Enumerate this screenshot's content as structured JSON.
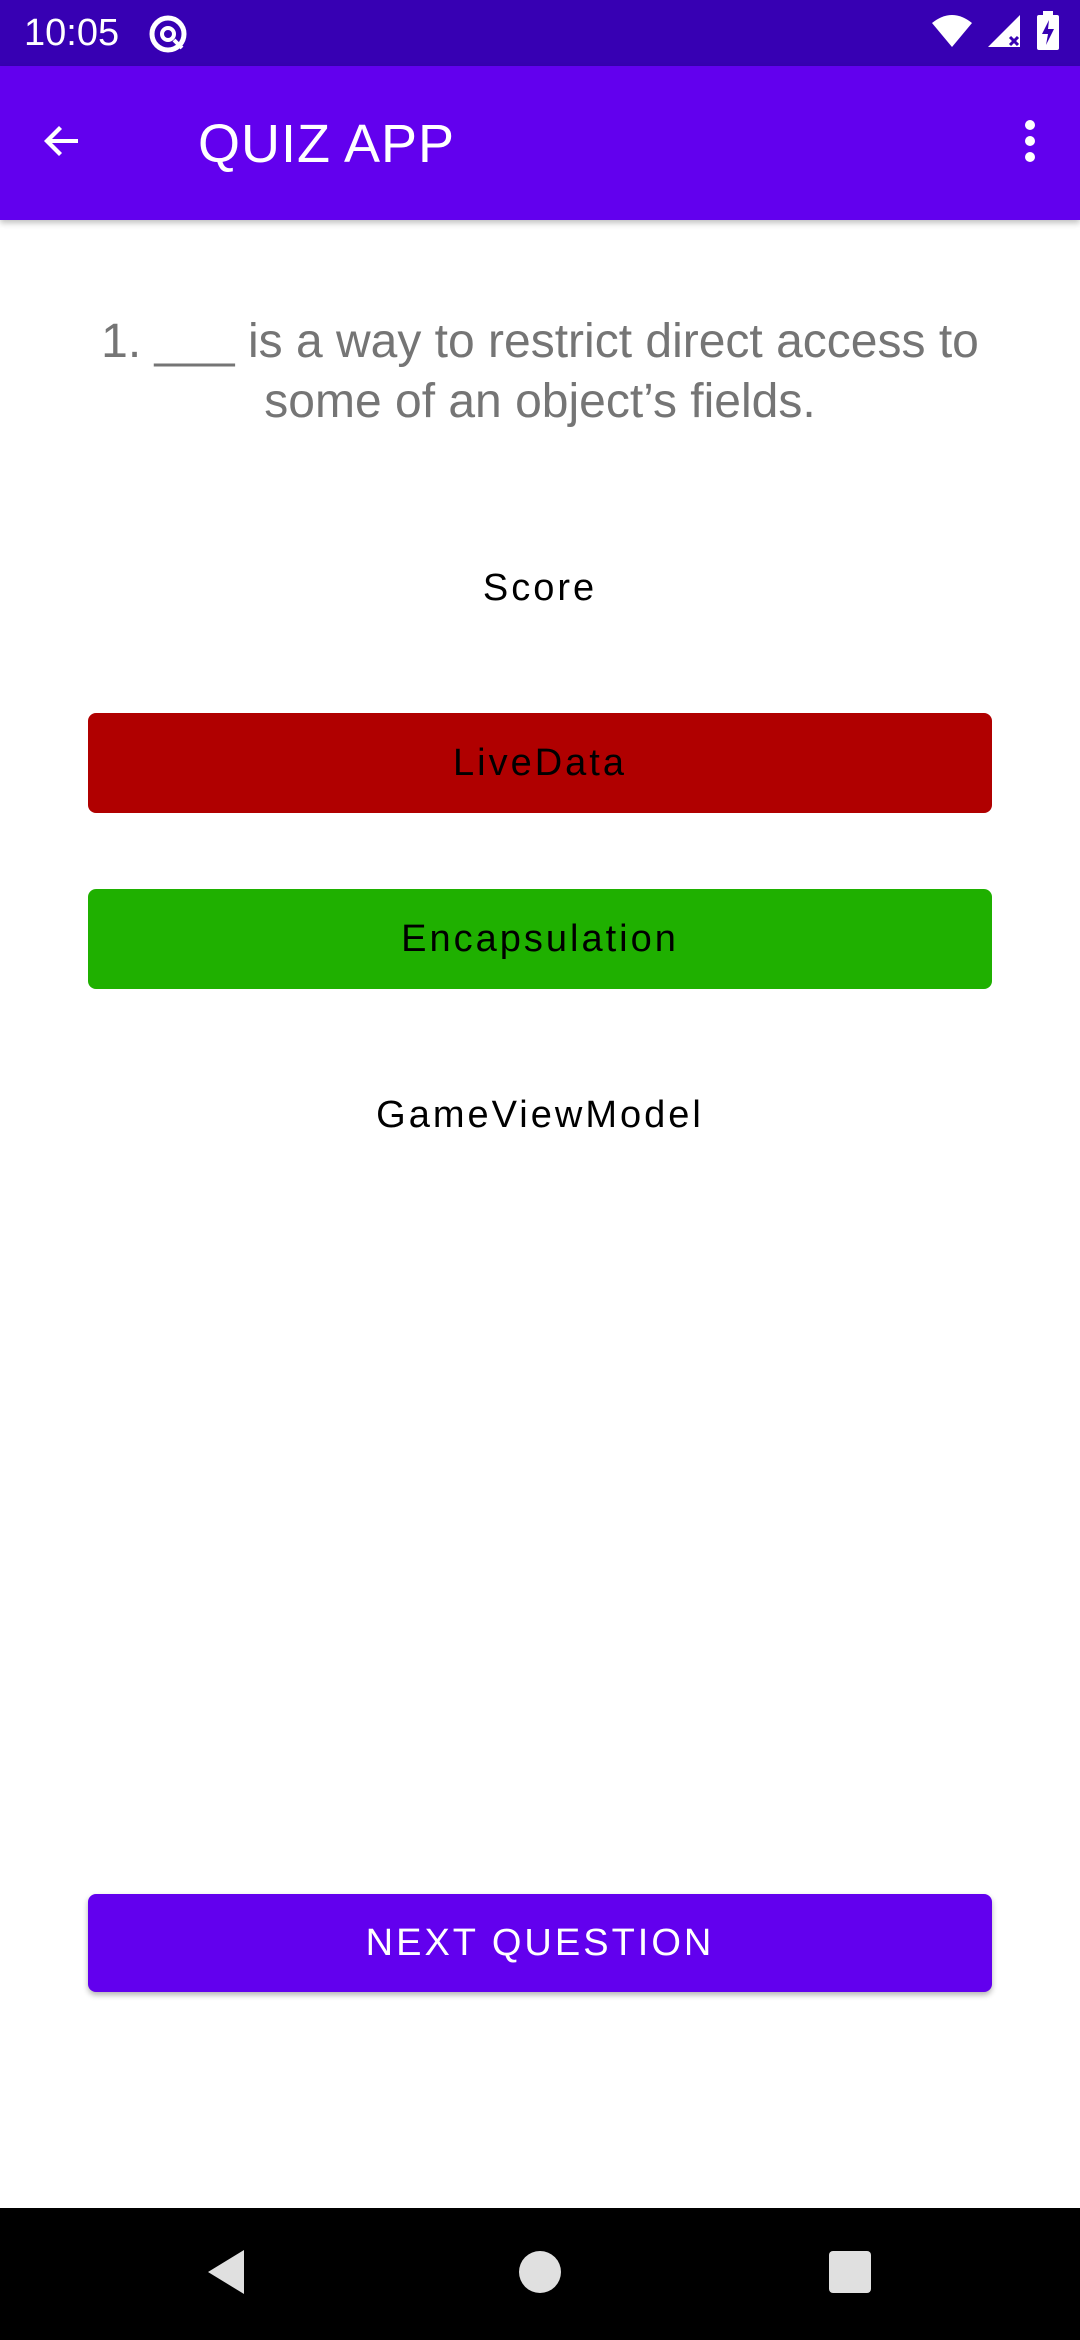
{
  "status_bar": {
    "time": "10:05",
    "icons": [
      "at-sign-icon",
      "wifi-icon",
      "cellular-signal-icon",
      "battery-charging-icon"
    ]
  },
  "app_bar": {
    "title": "QUIZ APP",
    "back_icon": "arrow-back-icon",
    "menu_icon": "more-vert-icon"
  },
  "quiz": {
    "question": "1. ___ is a way to restrict direct access to some of an object’s fields.",
    "options": [
      {
        "label": "Score",
        "state": "default"
      },
      {
        "label": "LiveData",
        "state": "wrong",
        "color": "#b00000"
      },
      {
        "label": "Encapsulation",
        "state": "correct",
        "color": "#1fb000"
      },
      {
        "label": "GameViewModel",
        "state": "default"
      }
    ],
    "next_button": "NEXT QUESTION"
  },
  "nav_bar": {
    "icons": [
      "back-triangle-icon",
      "home-circle-icon",
      "recents-square-icon"
    ]
  },
  "colors": {
    "status_bar": "#3700b3",
    "primary": "#6200ee",
    "wrong": "#b00000",
    "correct": "#1fb000"
  }
}
